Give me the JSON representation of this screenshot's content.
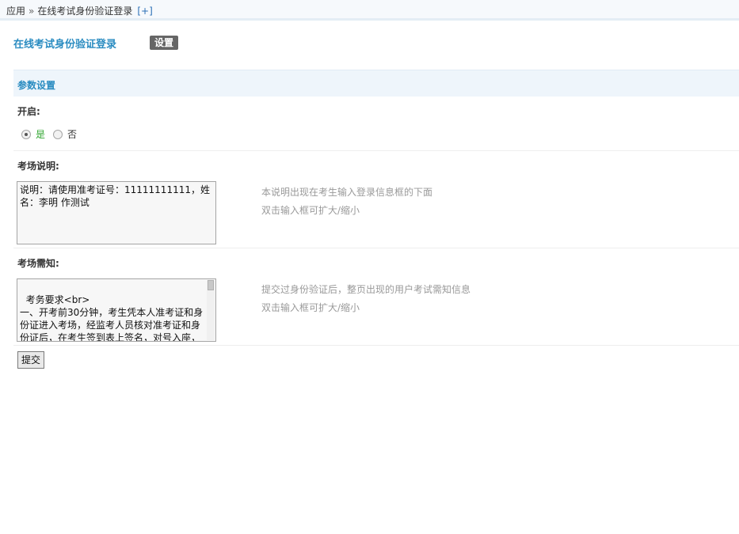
{
  "breadcrumb": {
    "root": "应用",
    "separator": "»",
    "current": "在线考试身份验证登录",
    "add_link": "[+]"
  },
  "page": {
    "title": "在线考试身份验证登录",
    "settings_button": "设置"
  },
  "section": {
    "title": "参数设置"
  },
  "enable": {
    "label": "开启:",
    "options": [
      "是",
      "否"
    ],
    "selected": "是"
  },
  "exam_note": {
    "label": "考场说明:",
    "value": "说明：请使用准考证号：11111111111，姓名：李明 作测试",
    "hint_1": "本说明出现在考生输入登录信息框的下面",
    "hint_2": "双击输入框可扩大/缩小"
  },
  "exam_notice": {
    "label": "考场需知:",
    "value": "考务要求<br>\n一、开考前30分钟，考生凭本人准考证和身份证进入考场，经监考人员核对准考证和身份证后，在考生签到表上签名，对号入座，将准考证和身份证放置在桌面上，",
    "hint_1": "提交过身份验证后，整页出现的用户考试需知信息",
    "hint_2": "双击输入框可扩大/缩小"
  },
  "submit_button": "提交"
}
